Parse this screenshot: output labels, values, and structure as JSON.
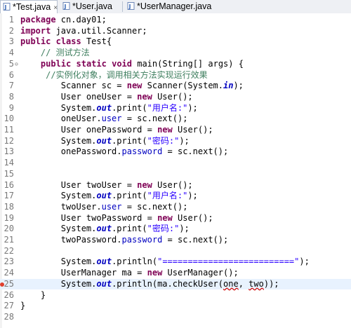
{
  "tabs": [
    {
      "label": "*Test.java",
      "close": "×",
      "active": true
    },
    {
      "label": "*User.java",
      "close": "",
      "active": false
    },
    {
      "label": "*UserManager.java",
      "close": "",
      "active": false
    }
  ],
  "colors": {
    "keyword": "#7f0055",
    "comment": "#3f7f5f",
    "string": "#2a00ff",
    "field": "#0000c0",
    "current_line": "#e8f2fe"
  },
  "lines": [
    {
      "n": "1",
      "segs": [
        [
          "kw",
          "package"
        ],
        [
          "p",
          " cn.day01;"
        ]
      ]
    },
    {
      "n": "2",
      "segs": [
        [
          "kw",
          "import"
        ],
        [
          "p",
          " java.util.Scanner;"
        ]
      ]
    },
    {
      "n": "3",
      "segs": [
        [
          "kw",
          "public"
        ],
        [
          "p",
          " "
        ],
        [
          "kw",
          "class"
        ],
        [
          "p",
          " Test{"
        ]
      ]
    },
    {
      "n": "4",
      "segs": [
        [
          "p",
          "    "
        ],
        [
          "cmt",
          "// 测试方法"
        ]
      ]
    },
    {
      "n": "5",
      "fold": "⊖",
      "segs": [
        [
          "p",
          "    "
        ],
        [
          "kw",
          "public"
        ],
        [
          "p",
          " "
        ],
        [
          "kw",
          "static"
        ],
        [
          "p",
          " "
        ],
        [
          "kw",
          "void"
        ],
        [
          "p",
          " main(String[] args) {"
        ]
      ]
    },
    {
      "n": "6",
      "segs": [
        [
          "p",
          "     "
        ],
        [
          "cmt",
          "//实例化对象，调用相关方法实现运行效果"
        ]
      ]
    },
    {
      "n": "7",
      "segs": [
        [
          "p",
          "        Scanner sc = "
        ],
        [
          "kw",
          "new"
        ],
        [
          "p",
          " Scanner(System."
        ],
        [
          "sfld",
          "in"
        ],
        [
          "p",
          ");"
        ]
      ]
    },
    {
      "n": "8",
      "segs": [
        [
          "p",
          "        User oneUser = "
        ],
        [
          "kw",
          "new"
        ],
        [
          "p",
          " User();"
        ]
      ]
    },
    {
      "n": "9",
      "segs": [
        [
          "p",
          "        System."
        ],
        [
          "sfld",
          "out"
        ],
        [
          "p",
          ".print("
        ],
        [
          "str",
          "\"用户名:\""
        ],
        [
          "p",
          ");"
        ]
      ]
    },
    {
      "n": "10",
      "segs": [
        [
          "p",
          "        oneUser."
        ],
        [
          "fld",
          "user"
        ],
        [
          "p",
          " = sc.next();"
        ]
      ]
    },
    {
      "n": "11",
      "segs": [
        [
          "p",
          "        User onePassword = "
        ],
        [
          "kw",
          "new"
        ],
        [
          "p",
          " User();"
        ]
      ]
    },
    {
      "n": "12",
      "segs": [
        [
          "p",
          "        System."
        ],
        [
          "sfld",
          "out"
        ],
        [
          "p",
          ".print("
        ],
        [
          "str",
          "\"密码:\""
        ],
        [
          "p",
          ");"
        ]
      ]
    },
    {
      "n": "13",
      "segs": [
        [
          "p",
          "        onePassword."
        ],
        [
          "fld",
          "password"
        ],
        [
          "p",
          " = sc.next();"
        ]
      ]
    },
    {
      "n": "14",
      "segs": []
    },
    {
      "n": "15",
      "segs": []
    },
    {
      "n": "16",
      "segs": [
        [
          "p",
          "        User twoUser = "
        ],
        [
          "kw",
          "new"
        ],
        [
          "p",
          " User();"
        ]
      ]
    },
    {
      "n": "17",
      "segs": [
        [
          "p",
          "        System."
        ],
        [
          "sfld",
          "out"
        ],
        [
          "p",
          ".print("
        ],
        [
          "str",
          "\"用户名:\""
        ],
        [
          "p",
          ");"
        ]
      ]
    },
    {
      "n": "18",
      "segs": [
        [
          "p",
          "        twoUser."
        ],
        [
          "fld",
          "user"
        ],
        [
          "p",
          " = sc.next();"
        ]
      ]
    },
    {
      "n": "19",
      "segs": [
        [
          "p",
          "        User twoPassword = "
        ],
        [
          "kw",
          "new"
        ],
        [
          "p",
          " User();"
        ]
      ]
    },
    {
      "n": "20",
      "segs": [
        [
          "p",
          "        System."
        ],
        [
          "sfld",
          "out"
        ],
        [
          "p",
          ".print("
        ],
        [
          "str",
          "\"密码:\""
        ],
        [
          "p",
          ");"
        ]
      ]
    },
    {
      "n": "21",
      "segs": [
        [
          "p",
          "        twoPassword."
        ],
        [
          "fld",
          "password"
        ],
        [
          "p",
          " = sc.next();"
        ]
      ]
    },
    {
      "n": "22",
      "segs": []
    },
    {
      "n": "23",
      "segs": [
        [
          "p",
          "        System."
        ],
        [
          "sfld",
          "out"
        ],
        [
          "p",
          ".println("
        ],
        [
          "str",
          "\"==========================\""
        ],
        [
          "p",
          ");"
        ]
      ]
    },
    {
      "n": "24",
      "segs": [
        [
          "p",
          "        UserManager ma = "
        ],
        [
          "kw",
          "new"
        ],
        [
          "p",
          " UserManager();"
        ]
      ]
    },
    {
      "n": "25",
      "current": true,
      "marker": true,
      "segs": [
        [
          "p",
          "        System."
        ],
        [
          "sfld",
          "out"
        ],
        [
          "p",
          ".println(ma.checkUser("
        ],
        [
          "sq",
          "one"
        ],
        [
          "p",
          ", "
        ],
        [
          "sq",
          "two"
        ],
        [
          "p",
          "));"
        ]
      ]
    },
    {
      "n": "26",
      "segs": [
        [
          "p",
          "    }"
        ]
      ]
    },
    {
      "n": "27",
      "segs": [
        [
          "p",
          "}"
        ]
      ]
    },
    {
      "n": "28",
      "segs": []
    }
  ]
}
